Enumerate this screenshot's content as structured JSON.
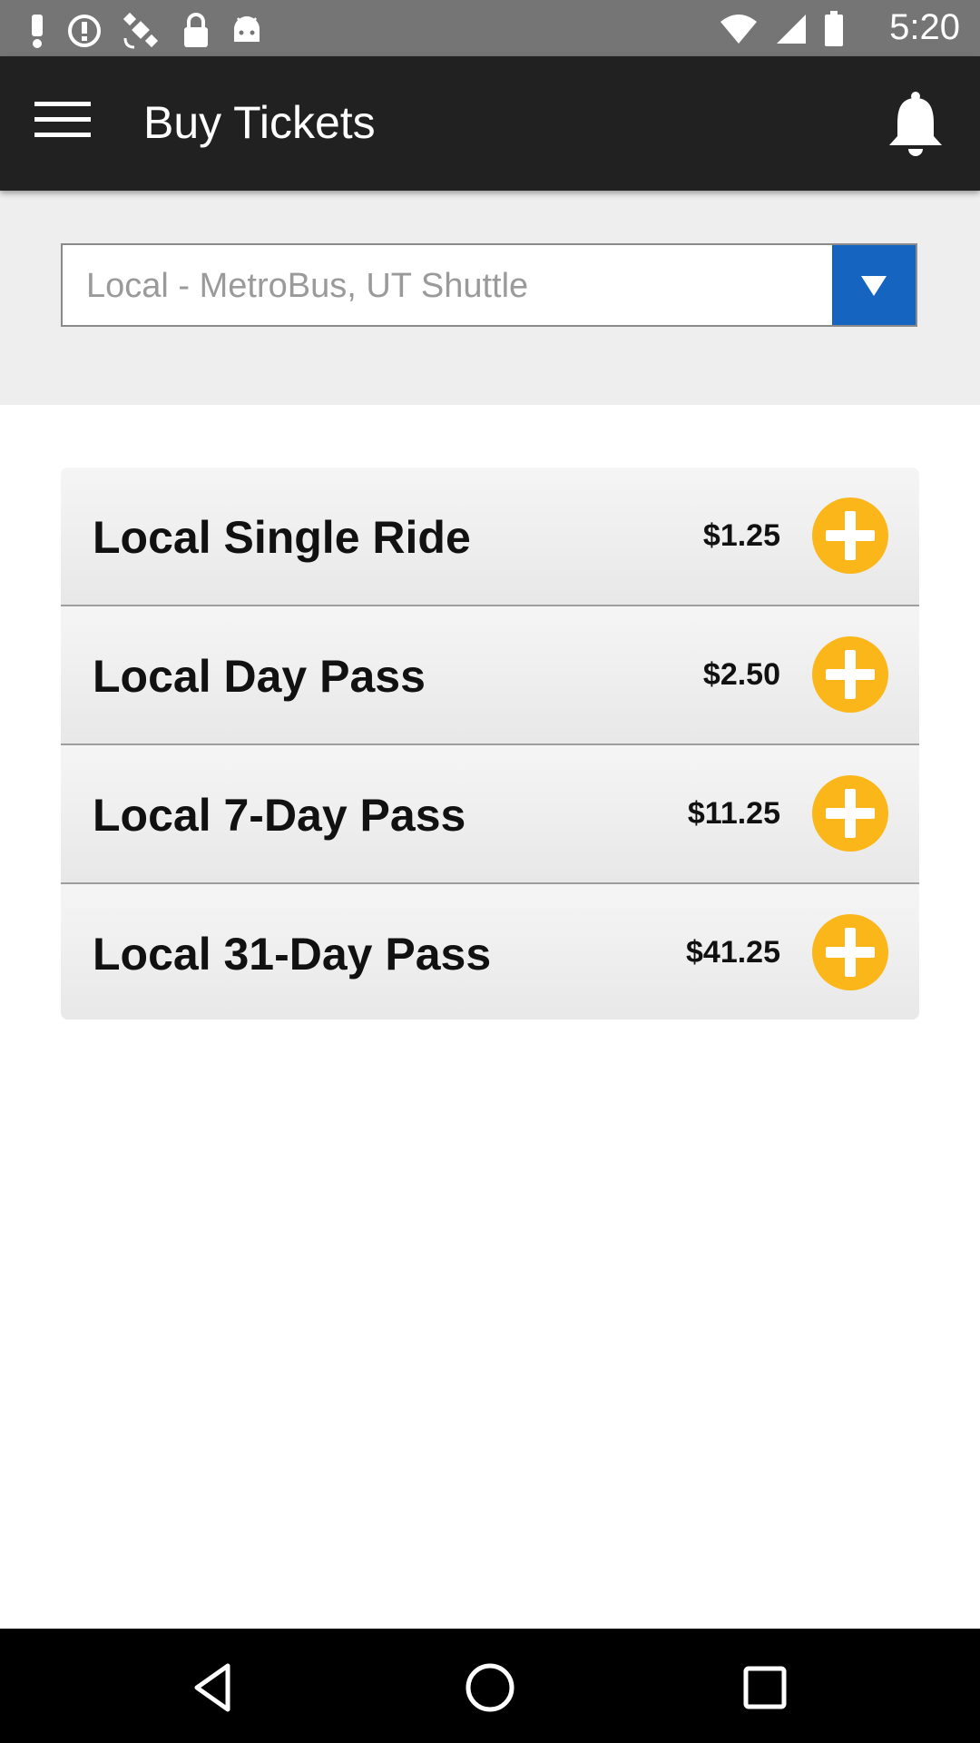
{
  "status_bar": {
    "time": "5:20",
    "icons": [
      "alert-icon",
      "info-icon",
      "satellite-icon",
      "lock-icon",
      "android-icon",
      "wifi-icon",
      "signal-icon",
      "battery-icon"
    ]
  },
  "app_bar": {
    "title": "Buy Tickets",
    "menu_icon": "menu-icon",
    "notification_icon": "bell-icon"
  },
  "filter": {
    "selected": "Local - MetroBus, UT Shuttle",
    "arrow_icon": "dropdown-arrow-icon"
  },
  "tickets": [
    {
      "name": "Local Single Ride",
      "price": "$1.25"
    },
    {
      "name": "Local Day Pass",
      "price": "$2.50"
    },
    {
      "name": "Local 7-Day Pass",
      "price": "$11.25"
    },
    {
      "name": "Local 31-Day Pass",
      "price": "$41.25"
    }
  ],
  "colors": {
    "status_bar": "#757575",
    "app_bar": "#212121",
    "filter_background": "#eeeeee",
    "dropdown_accent": "#1565c0",
    "add_button": "#fbb61a",
    "nav_bar": "#000000"
  },
  "nav_bar": {
    "icons": [
      "back-icon",
      "home-icon",
      "recent-apps-icon"
    ]
  }
}
